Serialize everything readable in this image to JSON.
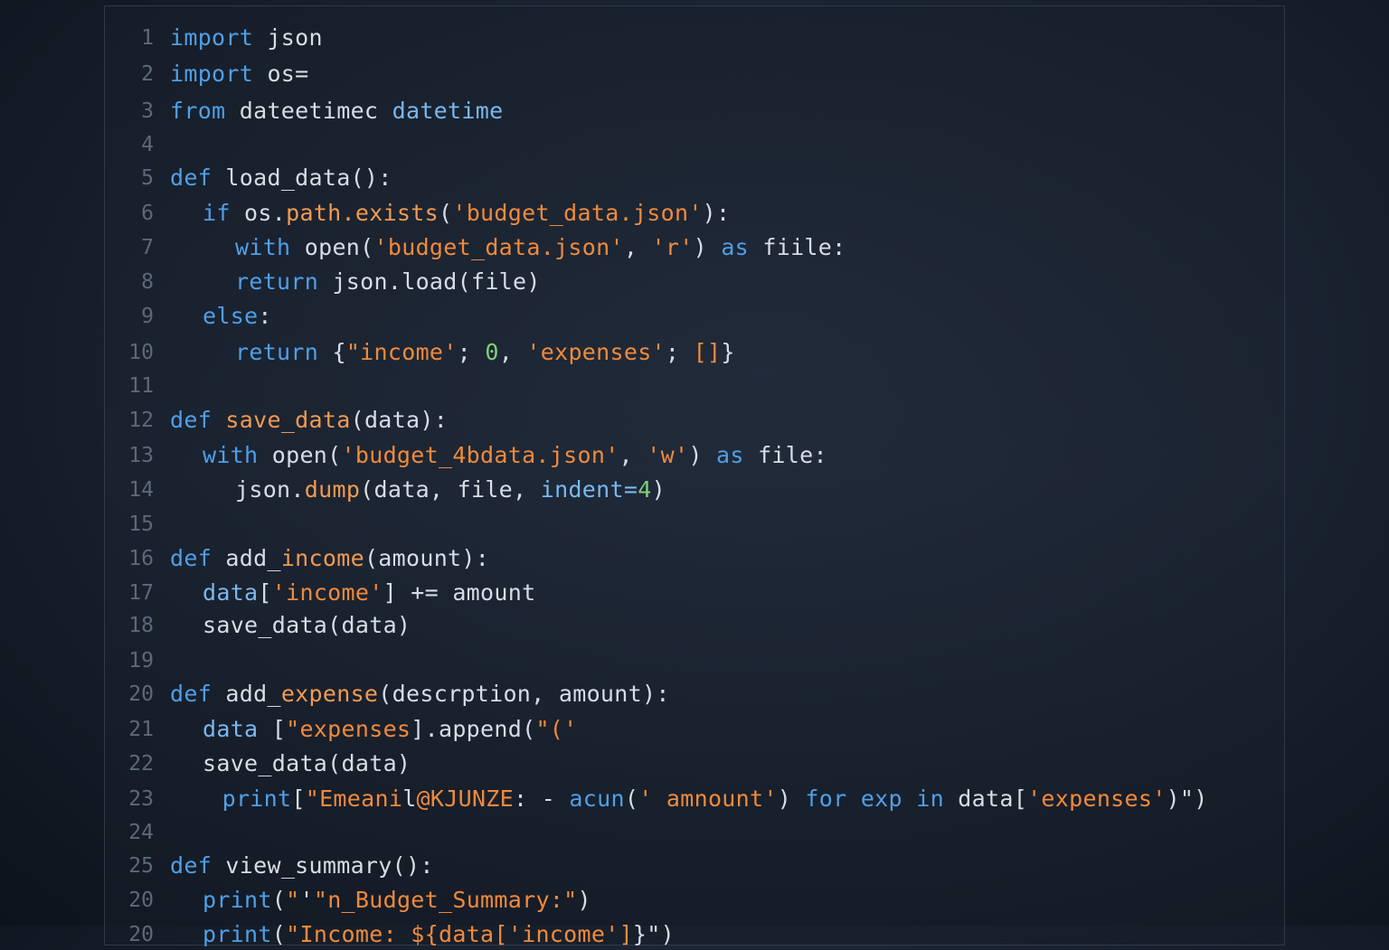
{
  "editor": {
    "lines": [
      {
        "n": "1",
        "indent": 0,
        "tokens": [
          {
            "t": "import",
            "c": "kw"
          },
          {
            "t": " json",
            "c": "plain"
          }
        ]
      },
      {
        "n": "2",
        "indent": 0,
        "tokens": [
          {
            "t": "import",
            "c": "kw"
          },
          {
            "t": " os=",
            "c": "plain"
          }
        ]
      },
      {
        "n": "3",
        "indent": 0,
        "tokens": [
          {
            "t": "from",
            "c": "kw"
          },
          {
            "t": " dateetimec ",
            "c": "plain"
          },
          {
            "t": "datetime",
            "c": "param"
          }
        ]
      },
      {
        "n": "4",
        "indent": 0,
        "tokens": []
      },
      {
        "n": "5",
        "indent": 0,
        "tokens": [
          {
            "t": "def",
            "c": "kw"
          },
          {
            "t": " load_data():",
            "c": "plain"
          }
        ]
      },
      {
        "n": "6",
        "indent": 1,
        "tokens": [
          {
            "t": "if",
            "c": "kw"
          },
          {
            "t": " os.",
            "c": "plain"
          },
          {
            "t": "path.exists",
            "c": "attr"
          },
          {
            "t": "(",
            "c": "plain"
          },
          {
            "t": "'budget_data.json'",
            "c": "str"
          },
          {
            "t": "):",
            "c": "plain"
          }
        ]
      },
      {
        "n": "7",
        "indent": 2,
        "tokens": [
          {
            "t": "with",
            "c": "kw"
          },
          {
            "t": " open(",
            "c": "plain"
          },
          {
            "t": "'budget_data.json'",
            "c": "str"
          },
          {
            "t": ", ",
            "c": "plain"
          },
          {
            "t": "'r'",
            "c": "str"
          },
          {
            "t": ") ",
            "c": "plain"
          },
          {
            "t": "as",
            "c": "kw"
          },
          {
            "t": " fiile:",
            "c": "plain"
          }
        ]
      },
      {
        "n": "8",
        "indent": 2,
        "tokens": [
          {
            "t": "return",
            "c": "kw"
          },
          {
            "t": " json.load(file)",
            "c": "plain"
          }
        ]
      },
      {
        "n": "9",
        "indent": 1,
        "tokens": [
          {
            "t": "else",
            "c": "kw"
          },
          {
            "t": ":",
            "c": "plain"
          }
        ]
      },
      {
        "n": "10",
        "indent": 2,
        "tokens": [
          {
            "t": "return",
            "c": "kw"
          },
          {
            "t": " {",
            "c": "plain"
          },
          {
            "t": "\"income'",
            "c": "str"
          },
          {
            "t": "; ",
            "c": "plain"
          },
          {
            "t": "0",
            "c": "num"
          },
          {
            "t": ", ",
            "c": "plain"
          },
          {
            "t": "'expenses'",
            "c": "str"
          },
          {
            "t": "; ",
            "c": "plain"
          },
          {
            "t": "[]",
            "c": "str"
          },
          {
            "t": "}",
            "c": "plain"
          }
        ]
      },
      {
        "n": "11",
        "indent": 0,
        "tokens": []
      },
      {
        "n": "12",
        "indent": 0,
        "tokens": [
          {
            "t": "def",
            "c": "kw"
          },
          {
            "t": " ",
            "c": "plain"
          },
          {
            "t": "save_data",
            "c": "attr"
          },
          {
            "t": "(data):",
            "c": "plain"
          }
        ]
      },
      {
        "n": "13",
        "indent": 1,
        "tokens": [
          {
            "t": "with",
            "c": "kw"
          },
          {
            "t": " open(",
            "c": "plain"
          },
          {
            "t": "'budget_4bdata.json'",
            "c": "str"
          },
          {
            "t": ", ",
            "c": "plain"
          },
          {
            "t": "'w'",
            "c": "str"
          },
          {
            "t": ") ",
            "c": "plain"
          },
          {
            "t": "as",
            "c": "kw"
          },
          {
            "t": " file:",
            "c": "plain"
          }
        ]
      },
      {
        "n": "14",
        "indent": 2,
        "tokens": [
          {
            "t": "json.",
            "c": "plain"
          },
          {
            "t": "dump",
            "c": "attr"
          },
          {
            "t": "(data, file, ",
            "c": "plain"
          },
          {
            "t": "indent=",
            "c": "param"
          },
          {
            "t": "4",
            "c": "num"
          },
          {
            "t": ")",
            "c": "plain"
          }
        ]
      },
      {
        "n": "15",
        "indent": 0,
        "tokens": []
      },
      {
        "n": "16",
        "indent": 0,
        "tokens": [
          {
            "t": "def",
            "c": "kw"
          },
          {
            "t": " add_",
            "c": "plain"
          },
          {
            "t": "income",
            "c": "attr"
          },
          {
            "t": "(amount):",
            "c": "plain"
          }
        ]
      },
      {
        "n": "17",
        "indent": 1,
        "tokens": [
          {
            "t": "data",
            "c": "param"
          },
          {
            "t": "[",
            "c": "plain"
          },
          {
            "t": "'income'",
            "c": "str"
          },
          {
            "t": "] += amount",
            "c": "plain"
          }
        ]
      },
      {
        "n": "18",
        "indent": 1,
        "tokens": [
          {
            "t": "save_data(data)",
            "c": "plain"
          }
        ]
      },
      {
        "n": "19",
        "indent": 0,
        "tokens": []
      },
      {
        "n": "20",
        "indent": 0,
        "tokens": [
          {
            "t": "def",
            "c": "kw"
          },
          {
            "t": " add_",
            "c": "plain"
          },
          {
            "t": "expense",
            "c": "attr"
          },
          {
            "t": "(descrption, amount):",
            "c": "plain"
          }
        ]
      },
      {
        "n": "21",
        "indent": 1,
        "tokens": [
          {
            "t": "data",
            "c": "param"
          },
          {
            "t": " [",
            "c": "plain"
          },
          {
            "t": "\"expenses",
            "c": "str"
          },
          {
            "t": "].append(",
            "c": "plain"
          },
          {
            "t": "\"('",
            "c": "str"
          }
        ]
      },
      {
        "n": "22",
        "indent": 1,
        "tokens": [
          {
            "t": "save_data(data)",
            "c": "plain"
          }
        ]
      },
      {
        "n": "23",
        "indent": 1.6,
        "tokens": [
          {
            "t": "print",
            "c": "kw"
          },
          {
            "t": "[",
            "c": "plain"
          },
          {
            "t": "\"Emeani",
            "c": "str"
          },
          {
            "t": "l",
            "c": "plain"
          },
          {
            "t": "@KJUNZE",
            "c": "str"
          },
          {
            "t": ": - ",
            "c": "plain"
          },
          {
            "t": "acun",
            "c": "kw"
          },
          {
            "t": "(",
            "c": "plain"
          },
          {
            "t": "' amnount'",
            "c": "str"
          },
          {
            "t": ") ",
            "c": "plain"
          },
          {
            "t": "for",
            "c": "kw"
          },
          {
            "t": " ",
            "c": "plain"
          },
          {
            "t": "exp",
            "c": "kw"
          },
          {
            "t": " ",
            "c": "plain"
          },
          {
            "t": "in",
            "c": "kw"
          },
          {
            "t": " data[",
            "c": "plain"
          },
          {
            "t": "'expenses'",
            "c": "str"
          },
          {
            "t": ")\")",
            "c": "plain"
          }
        ]
      },
      {
        "n": "24",
        "indent": 0,
        "tokens": []
      },
      {
        "n": "25",
        "indent": 0,
        "tokens": [
          {
            "t": "def",
            "c": "kw"
          },
          {
            "t": " view_summary():",
            "c": "plain"
          }
        ]
      },
      {
        "n": "20",
        "indent": 1,
        "tokens": [
          {
            "t": "print",
            "c": "kw"
          },
          {
            "t": "(",
            "c": "plain"
          },
          {
            "t": "\"",
            "c": "str"
          },
          {
            "t": "'",
            "c": "plain"
          },
          {
            "t": "\"n_Budget_Summary:\"",
            "c": "str"
          },
          {
            "t": ")",
            "c": "plain"
          }
        ]
      },
      {
        "n": "20",
        "indent": 1,
        "tokens": [
          {
            "t": "print",
            "c": "kw"
          },
          {
            "t": "(",
            "c": "plain"
          },
          {
            "t": "\"Income: $",
            "c": "str"
          },
          {
            "t": "{data",
            "c": "str"
          },
          {
            "t": "['income']",
            "c": "str"
          },
          {
            "t": "}\")",
            "c": "plain"
          }
        ]
      }
    ]
  }
}
